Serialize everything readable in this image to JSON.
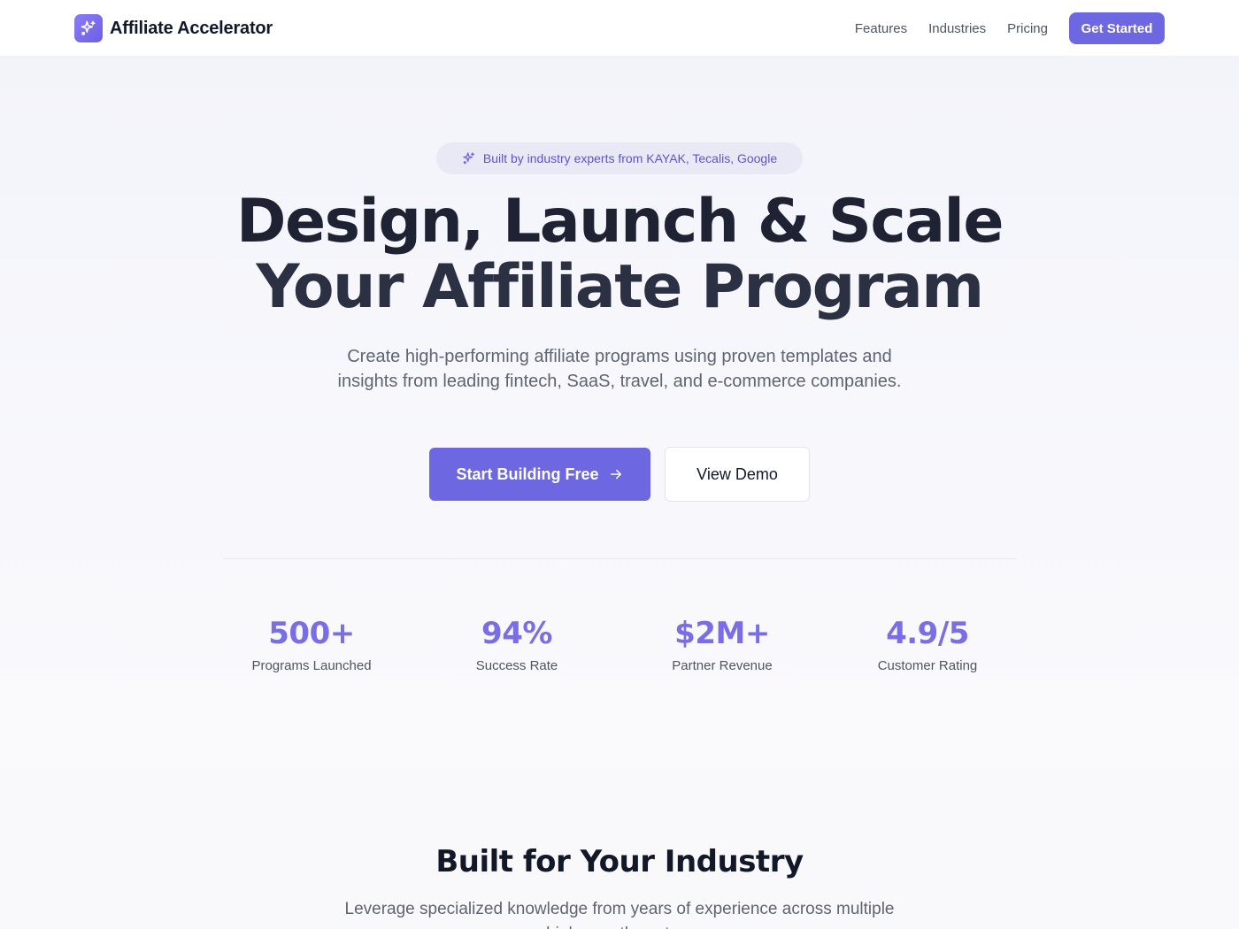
{
  "nav": {
    "brand": "Affiliate Accelerator",
    "links": [
      "Features",
      "Industries",
      "Pricing"
    ],
    "cta": "Get Started",
    "logo_icon": "sparkles-icon"
  },
  "hero": {
    "badge": "Built by industry experts from KAYAK, Tecalis, Google",
    "headline_line1": "Design, Launch & Scale",
    "headline_line2": "Your Affiliate Program",
    "subtitle": "Create high-performing affiliate programs using proven templates and insights from leading fintech, SaaS, travel, and e-commerce companies.",
    "primary_button": "Start Building Free",
    "secondary_button": "View Demo"
  },
  "stats": [
    {
      "value": "500+",
      "label": "Programs Launched"
    },
    {
      "value": "94%",
      "label": "Success Rate"
    },
    {
      "value": "$2M+",
      "label": "Partner Revenue"
    },
    {
      "value": "4.9/5",
      "label": "Customer Rating"
    }
  ],
  "industry": {
    "title": "Built for Your Industry",
    "subtitle": "Leverage specialized knowledge from years of experience across multiple high-growth sectors"
  },
  "colors": {
    "accent": "#6e67e2",
    "stat": "#7a6ee6",
    "heading": "#1e2233"
  }
}
